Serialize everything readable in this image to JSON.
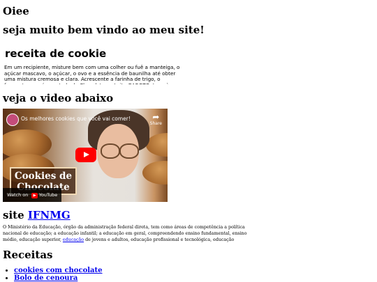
{
  "heading_greeting": "Oiee",
  "heading_welcome": "seja muito bem vindo ao meu site!",
  "recipe": {
    "title": "receita de cookie",
    "text": "Em um recipiente, misture bem com uma colher ou fuê a manteiga, o açúcar mascavo, o açúcar, o ovo e a essência de baunilha até obter uma mistura cremosa e clara. Acrescente a farinha de trigo, o fermento em pó e metade do Chocolate ao Leite GAROTO. Leve à geladeira"
  },
  "video_section": {
    "heading": "veja o video abaixo",
    "title": "Os melhores cookies que você vai comer!",
    "share_label": "Share",
    "overlay_text": "Cookies de Chocolate",
    "watch_on": "Watch on",
    "youtube_label": "YouTube"
  },
  "site_section": {
    "heading_prefix": "site",
    "link_text": "IFNMG",
    "description_before_link": "O Ministério da Educação, órgão da administração federal direta, tem como áreas de competência a política nacional de educação; a educação infantil; a educação em geral, compreendendo ensino fundamental, ensino médio, educação superior,",
    "description_link": "educação",
    "description_after_link": "de jovens e adultos, educação profissional e tecnológica, educação"
  },
  "recipes_section": {
    "heading": "Receitas",
    "items": [
      {
        "label": "cookies com chocolate"
      },
      {
        "label": "Bolo de cenoura"
      }
    ]
  }
}
